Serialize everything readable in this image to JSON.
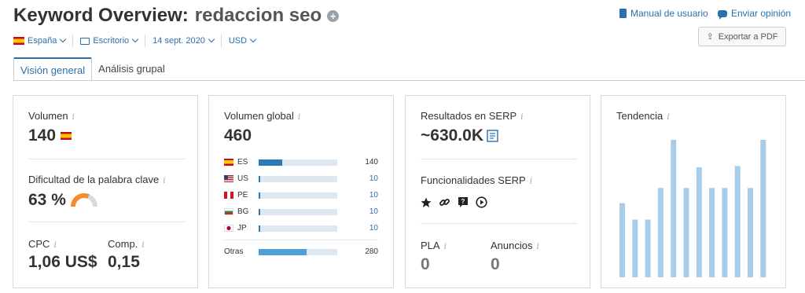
{
  "header": {
    "title": "Keyword Overview:",
    "keyword": "redaccion seo",
    "manual_label": "Manual de usuario",
    "feedback_label": "Enviar opinión",
    "export_label": "Exportar a PDF"
  },
  "filters": {
    "country": "España",
    "device": "Escritorio",
    "date": "14 sept. 2020",
    "currency": "USD"
  },
  "tabs": [
    {
      "label": "Visión general",
      "active": true
    },
    {
      "label": "Análisis grupal",
      "active": false
    }
  ],
  "volume": {
    "label": "Volumen",
    "value": "140",
    "difficulty_label": "Dificultad de la palabra clave",
    "difficulty_value": "63 %",
    "difficulty_level": 0.63,
    "cpc_label": "CPC",
    "cpc_value": "1,06 US$",
    "comp_label": "Comp.",
    "comp_value": "0,15"
  },
  "global": {
    "label": "Volumen global",
    "value": "460",
    "rows": [
      {
        "code": "ES",
        "value": "140",
        "share": 0.3
      },
      {
        "code": "US",
        "value": "10",
        "share": 0.02
      },
      {
        "code": "PE",
        "value": "10",
        "share": 0.02
      },
      {
        "code": "BG",
        "value": "10",
        "share": 0.02
      },
      {
        "code": "JP",
        "value": "10",
        "share": 0.02
      }
    ],
    "other_label": "Otras",
    "other_value": "280",
    "other_share": 0.61
  },
  "serp": {
    "label": "Resultados en SERP",
    "value": "~630.0K",
    "features_label": "Funcionalidades SERP",
    "features": [
      "star-icon",
      "link-icon",
      "faq-icon",
      "video-icon"
    ],
    "pla_label": "PLA",
    "pla_value": "0",
    "ads_label": "Anuncios",
    "ads_value": "0"
  },
  "trend": {
    "label": "Tendencia",
    "bar_color": "#a9cde8",
    "values": [
      0.54,
      0.42,
      0.42,
      0.65,
      1.0,
      0.65,
      0.8,
      0.65,
      0.65,
      0.81,
      0.65,
      1.0
    ]
  },
  "colors": {
    "accent": "#2a6fb0",
    "bar_fill": "#2a7ab8",
    "bar_track": "#dde8f3",
    "gauge": "#f58b2e"
  }
}
